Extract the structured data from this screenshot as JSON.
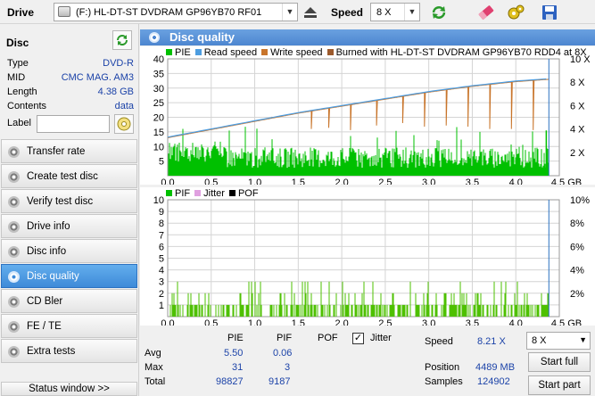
{
  "toolbar": {
    "drive_label": "Drive",
    "drive_value": "(F:)   HL-DT-ST DVDRAM GP96YB70 RF01",
    "speed_label": "Speed",
    "speed_value": "8 X"
  },
  "disc": {
    "title": "Disc",
    "rows": [
      {
        "key": "Type",
        "value": "DVD-R"
      },
      {
        "key": "MID",
        "value": "CMC MAG. AM3"
      },
      {
        "key": "Length",
        "value": "4.38 GB"
      },
      {
        "key": "Contents",
        "value": "data"
      }
    ],
    "label_key": "Label",
    "label_value": ""
  },
  "nav": {
    "items": [
      {
        "label": "Transfer rate",
        "active": false
      },
      {
        "label": "Create test disc",
        "active": false
      },
      {
        "label": "Verify test disc",
        "active": false
      },
      {
        "label": "Drive info",
        "active": false
      },
      {
        "label": "Disc info",
        "active": false
      },
      {
        "label": "Disc quality",
        "active": true
      },
      {
        "label": "CD Bler",
        "active": false
      },
      {
        "label": "FE / TE",
        "active": false
      },
      {
        "label": "Extra tests",
        "active": false
      }
    ],
    "status_window": "Status window >>"
  },
  "main": {
    "title": "Disc quality"
  },
  "chart_data": [
    {
      "type": "bar",
      "legend": [
        {
          "name": "PIE",
          "color": "#00c000"
        },
        {
          "name": "Read speed",
          "color": "#4d9de0"
        },
        {
          "name": "Write speed",
          "color": "#c8742a"
        },
        {
          "name": "Burned with HL-DT-ST DVDRAM GP96YB70 RDD4 at 8X",
          "color": "#9c5a2c"
        }
      ],
      "x_ticks": [
        "0.0",
        "0.5",
        "1.0",
        "1.5",
        "2.0",
        "2.5",
        "3.0",
        "3.5",
        "4.0",
        "4.5"
      ],
      "x_unit": "GB",
      "xlim": [
        0,
        4.5
      ],
      "ylim_left": [
        0,
        40
      ],
      "y_ticks_left": [
        "5",
        "10",
        "15",
        "20",
        "25",
        "30",
        "35",
        "40"
      ],
      "ylim_right": [
        0,
        10
      ],
      "y_ticks_right": [
        "2 X",
        "4 X",
        "6 X",
        "8 X",
        "10 X"
      ],
      "pie_baseline": 5.5,
      "pie_max": 31,
      "read_speed_x": [
        0.0,
        0.5,
        1.0,
        1.5,
        2.0,
        2.5,
        3.0,
        3.5,
        4.0,
        4.38
      ],
      "read_speed_y": [
        3.3,
        4.0,
        4.7,
        5.4,
        6.0,
        6.6,
        7.2,
        7.7,
        8.1,
        8.3
      ],
      "write_speed_dips_x": [
        1.2,
        1.65,
        1.85,
        2.1,
        2.4,
        2.7,
        2.95,
        3.2,
        3.45,
        3.7,
        3.95,
        4.2
      ],
      "write_speed_dips_y": [
        5.0,
        4.0,
        4.1,
        3.9,
        4.3,
        4.5,
        4.2,
        4.3,
        4.2,
        4.0,
        4.0,
        3.9
      ],
      "grid": true
    },
    {
      "type": "bar",
      "legend": [
        {
          "name": "PIF",
          "color": "#00c000"
        },
        {
          "name": "Jitter",
          "color": "#e0a0e0"
        },
        {
          "name": "POF",
          "color": "#000000"
        }
      ],
      "x_ticks": [
        "0.0",
        "0.5",
        "1.0",
        "1.5",
        "2.0",
        "2.5",
        "3.0",
        "3.5",
        "4.0",
        "4.5"
      ],
      "x_unit": "GB",
      "xlim": [
        0,
        4.5
      ],
      "ylim_left": [
        0,
        10
      ],
      "y_ticks_left": [
        "1",
        "2",
        "3",
        "4",
        "5",
        "6",
        "7",
        "8",
        "9",
        "10"
      ],
      "y_ticks_right": [
        "2%",
        "4%",
        "6%",
        "8%",
        "10%"
      ],
      "pif_max": 3,
      "grid": true
    }
  ],
  "stats": {
    "col_pie": "PIE",
    "col_pif": "PIF",
    "col_pof": "POF",
    "jitter_label": "Jitter",
    "jitter_checked": true,
    "rows": [
      {
        "label": "Avg",
        "pie": "5.50",
        "pif": "0.06"
      },
      {
        "label": "Max",
        "pie": "31",
        "pif": "3"
      },
      {
        "label": "Total",
        "pie": "98827",
        "pif": "9187"
      }
    ],
    "speed_label": "Speed",
    "speed_value": "8.21 X",
    "position_label": "Position",
    "position_value": "4489 MB",
    "samples_label": "Samples",
    "samples_value": "124902",
    "speed_select": "8 X",
    "start_full": "Start full",
    "start_part": "Start part"
  }
}
